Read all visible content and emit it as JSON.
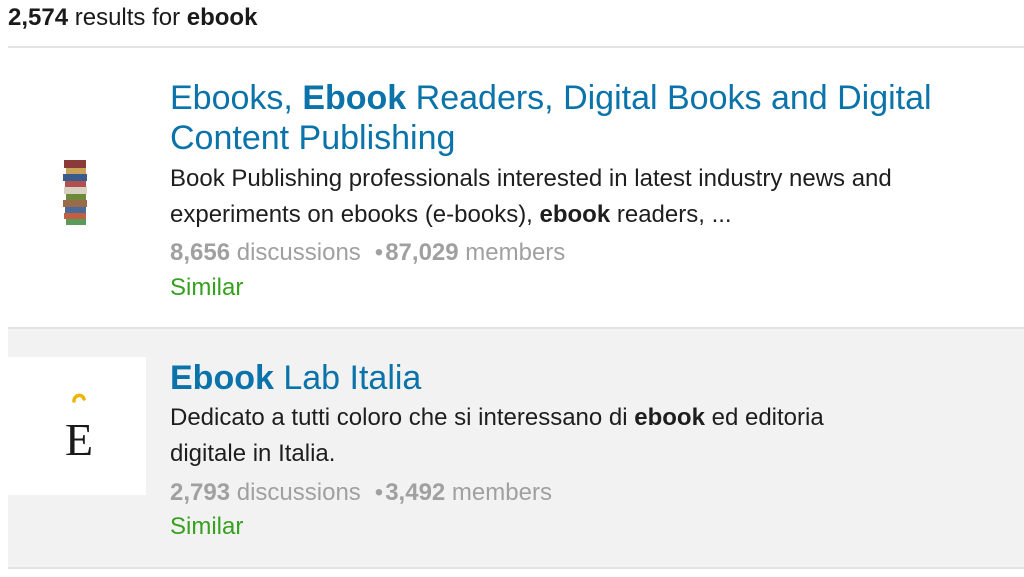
{
  "header": {
    "count": "2,574",
    "middle": " results for ",
    "query": "ebook"
  },
  "results": [
    {
      "title_line1_pre": "Ebooks, ",
      "title_line1_bold": "Ebook",
      "title_line1_post": " Readers, Digital Books and Digital",
      "title_line2": "Content Publishing",
      "desc_line1": "Book Publishing professionals interested in latest industry news and",
      "desc_line2_pre": "experiments on ebooks (e-books), ",
      "desc_line2_bold": "ebook",
      "desc_line2_post": " readers, ...",
      "discussions_count": "8,656",
      "discussions_label": " discussions",
      "members_count": "87,029",
      "members_label": " members",
      "similar": "Similar",
      "thumb_icon": "book-stack-icon"
    },
    {
      "title_bold": "Ebook",
      "title_post": " Lab Italia",
      "desc_line1_pre": "Dedicato a tutti coloro che si interessano di ",
      "desc_line1_bold": "ebook",
      "desc_line1_post": " ed editoria",
      "desc_line2": "digitale in Italia.",
      "discussions_count": "2,793",
      "discussions_label": " discussions",
      "members_count": "3,492",
      "members_label": " members",
      "similar": "Similar",
      "thumb_letter": "È",
      "thumb_icon": "e-grave-logo-icon"
    }
  ],
  "colors": {
    "link": "#0a73a9",
    "similar": "#36a11f",
    "muted": "#a0a0a0",
    "alt_row": "#f2f2f2"
  }
}
